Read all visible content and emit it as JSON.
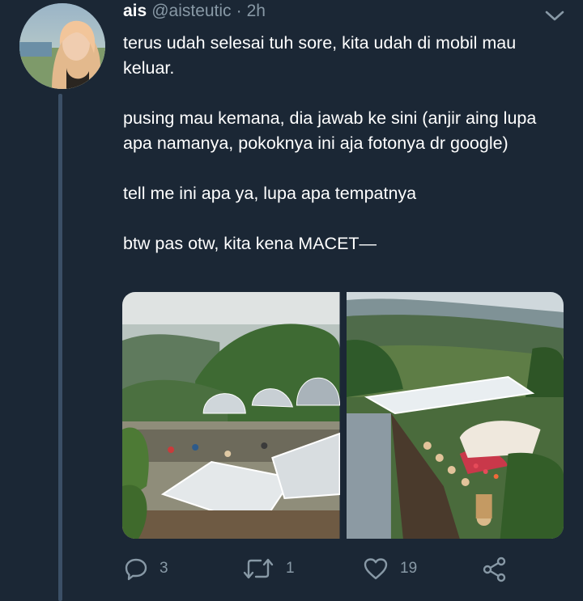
{
  "tweet": {
    "author_name": "ais",
    "author_handle": "@aisteutic",
    "separator": "·",
    "time": "2h",
    "text": "terus udah selesai tuh sore, kita udah di mobil mau keluar.\n\npusing mau kemana, dia jawab ke sini (anjir aing lupa apa namanya, pokoknya ini aja fotonya dr google)\n\ntell me ini apa ya, lupa apa tempatnya\n\nbtw pas otw, kita kena MACET—"
  },
  "media": {
    "photos": [
      {
        "name": "photo-glamping-domes"
      },
      {
        "name": "photo-terrace-cafe"
      }
    ]
  },
  "actions": {
    "reply_count": "3",
    "retweet_count": "1",
    "like_count": "19"
  },
  "icons": {
    "menu": "chevron-down-icon",
    "reply": "reply-icon",
    "retweet": "retweet-icon",
    "like": "heart-icon",
    "share": "share-icon"
  },
  "colors": {
    "background": "#1b2735",
    "secondary_text": "#8899a6",
    "thread_line": "#3b4f66"
  }
}
